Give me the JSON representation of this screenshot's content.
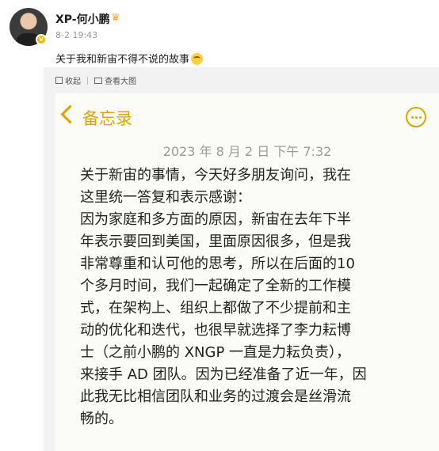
{
  "post": {
    "username": "XP-何小鹏",
    "timestamp": "8-2 19:43",
    "text": "关于我和新宙不得不说的故事",
    "emoji_icon": "grin-emoji-icon",
    "verified_icon": "verified-badge-icon"
  },
  "toolbar": {
    "save_label": "收起",
    "view_image_label": "查看大图"
  },
  "note": {
    "back_label": "备忘录",
    "accent_color": "#e0a400",
    "datetime": "2023 年 8 月 2 日  下午 7:32",
    "lines": [
      "关于新宙的事情，今天好多朋友询问，我在",
      "这里统一答复和表示感谢：",
      "因为家庭和多方面的原因，新宙在去年下半",
      "年表示要回到美国，里面原因很多，但是我",
      "非常尊重和认可他的思考，所以在后面的10",
      "个多月时间，我们一起确定了全新的工作模",
      "式，在架构上、组织上都做了不少提前和主",
      "动的优化和迭代，也很早就选择了李力耘博",
      "士（之前小鹏的 XNGP 一直是力耘负责），",
      "来接手 AD 团队。因为已经准备了近一年，因",
      "此我无比相信团队和业务的过渡会是丝滑流",
      "畅的。"
    ]
  }
}
